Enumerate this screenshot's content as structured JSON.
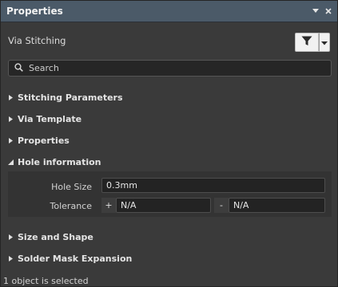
{
  "panel": {
    "title": "Properties",
    "dropdown_icon": "triangle-down-icon",
    "close_icon": "close-icon"
  },
  "header": {
    "object_type": "Via Stitching",
    "filter_icon": "filter-icon",
    "filter_dropdown_icon": "chevron-down-icon"
  },
  "search": {
    "placeholder": "Search",
    "value": ""
  },
  "sections": [
    {
      "label": "Stitching Parameters",
      "expanded": false
    },
    {
      "label": "Via Template",
      "expanded": false
    },
    {
      "label": "Properties",
      "expanded": false
    },
    {
      "label": "Hole information",
      "expanded": true
    },
    {
      "label": "Size and Shape",
      "expanded": false
    },
    {
      "label": "Solder Mask Expansion",
      "expanded": false
    }
  ],
  "hole_information": {
    "hole_size_label": "Hole Size",
    "hole_size_value": "0.3mm",
    "tolerance_label": "Tolerance",
    "tolerance_plus_sign": "+",
    "tolerance_plus_value": "N/A",
    "tolerance_minus_sign": "-",
    "tolerance_minus_value": "N/A"
  },
  "status": {
    "text": "1 object is selected"
  },
  "colors": {
    "titlebar": "#4b5a68",
    "panel_bg": "#3a3a3a",
    "field_bg": "#232323"
  }
}
